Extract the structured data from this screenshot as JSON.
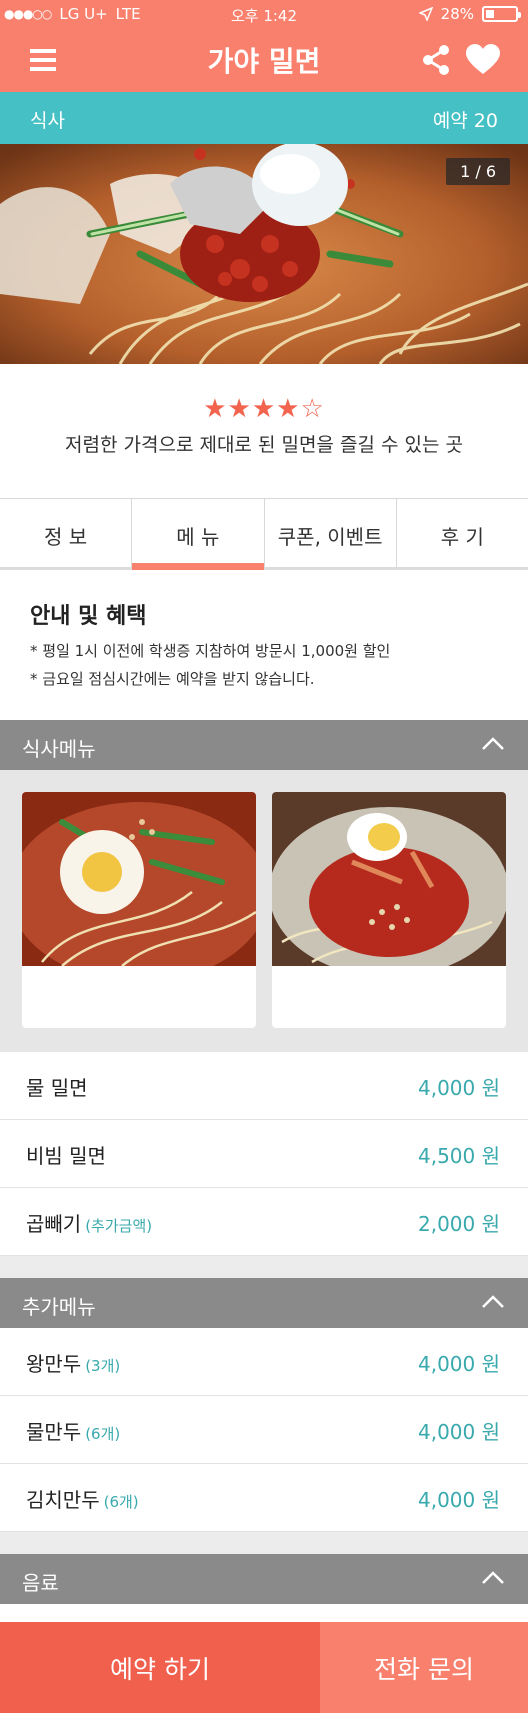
{
  "status_bar": {
    "carrier": "LG U+",
    "network": "LTE",
    "time": "오후 1:42",
    "battery": "28%",
    "battery_level": 0.28
  },
  "header": {
    "title": "가야 밀면",
    "menu_icon": "hamburger-menu-icon",
    "share_icon": "share-icon",
    "favorite_icon": "heart-icon"
  },
  "category_bar": {
    "category": "식사",
    "reservation": "예약 20"
  },
  "hero": {
    "counter": "1 / 6"
  },
  "summary": {
    "rating": 4,
    "rating_max": 5,
    "rating_stars": "★★★★☆",
    "tagline": "저렴한 가격으로 제대로 된 밀면을 즐길 수 있는 곳"
  },
  "tabs": [
    {
      "label": "정 보",
      "active": false
    },
    {
      "label": "메 뉴",
      "active": true
    },
    {
      "label": "쿠폰, 이벤트",
      "active": false
    },
    {
      "label": "후 기",
      "active": false
    }
  ],
  "notice": {
    "title": "안내 및 혜택",
    "lines": [
      "* 평일 1시 이전에 학생증 지참하여 방문시 1,000원 할인",
      "* 금요일 점심시간에는 예약을 받지 않습니다."
    ]
  },
  "sections": [
    {
      "title": "식사메뉴",
      "items": [
        {
          "name": "물 밀면",
          "sub": "",
          "price": "4,000 원"
        },
        {
          "name": "비빔 밀면",
          "sub": "",
          "price": "4,500 원"
        },
        {
          "name": "곱빼기",
          "sub": "(추가금액)",
          "price": "2,000 원"
        }
      ]
    },
    {
      "title": "추가메뉴",
      "items": [
        {
          "name": "왕만두",
          "sub": "(3개)",
          "price": "4,000 원"
        },
        {
          "name": "물만두",
          "sub": "(6개)",
          "price": "4,000 원"
        },
        {
          "name": "김치만두",
          "sub": "(6개)",
          "price": "4,000 원"
        }
      ]
    },
    {
      "title": "음료",
      "items": []
    }
  ],
  "actions": {
    "reserve": "예약 하기",
    "call": "전화 문의"
  },
  "colors": {
    "brand": "#f9806d",
    "accent": "#45c0c4",
    "price": "#39a9ad",
    "reserve_button": "#f0604d",
    "section_header": "#8a8a8a"
  }
}
